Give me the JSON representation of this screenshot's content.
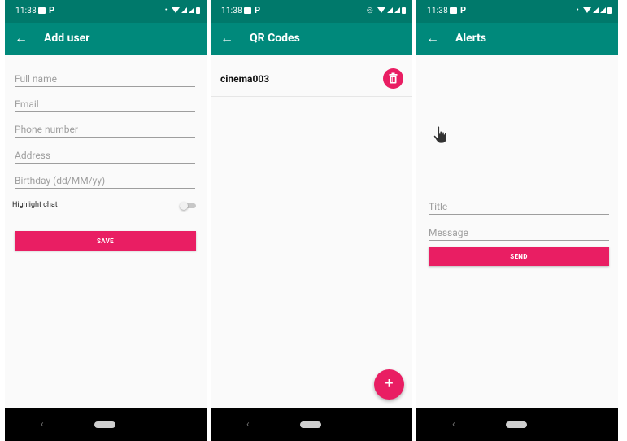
{
  "status_bar": {
    "time": "11:38",
    "app_icon": "P"
  },
  "screens": [
    {
      "title": "Add user",
      "fields": [
        {
          "placeholder": "Full name",
          "value": ""
        },
        {
          "placeholder": "Email",
          "value": ""
        },
        {
          "placeholder": "Phone number",
          "value": ""
        },
        {
          "placeholder": "Address",
          "value": ""
        },
        {
          "placeholder": "Birthday (dd/MM/yy)",
          "value": ""
        }
      ],
      "toggle": {
        "label": "Highlight chat",
        "checked": false
      },
      "button_label": "SAVE"
    },
    {
      "title": "QR Codes",
      "items": [
        {
          "name": "cinema003"
        }
      ],
      "fab_icon": "+"
    },
    {
      "title": "Alerts",
      "fields": [
        {
          "placeholder": "Title",
          "value": ""
        },
        {
          "placeholder": "Message",
          "value": ""
        }
      ],
      "button_label": "SEND"
    }
  ],
  "colors": {
    "status_bar": "#00796b",
    "app_bar": "#00897b",
    "accent": "#e91e63",
    "background": "#fafafa"
  },
  "icons": [
    "back-arrow-icon",
    "trash-icon",
    "plus-icon",
    "hand-cursor-icon",
    "nav-back-icon",
    "nav-home-pill"
  ]
}
